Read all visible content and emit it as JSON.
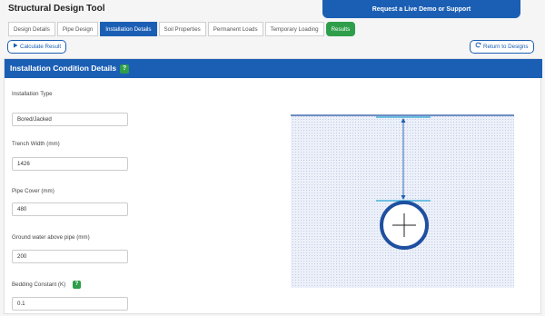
{
  "app": {
    "title": "Structural Design Tool",
    "demo_banner": "Request a Live Demo or Support"
  },
  "tabs": [
    {
      "label": "Design Details"
    },
    {
      "label": "Pipe Design"
    },
    {
      "label": "Installation Details"
    },
    {
      "label": "Soil Properties"
    },
    {
      "label": "Permanent Loads"
    },
    {
      "label": "Temporary Loading"
    },
    {
      "label": "Results"
    }
  ],
  "active_tab": "Installation Details",
  "toolbar": {
    "calculate_label": "Calculate Result",
    "return_label": "Return to Designs"
  },
  "section": {
    "title": "Installation Condition Details",
    "help": "?"
  },
  "fields": {
    "installation_type": {
      "label": "Installation Type",
      "value": "Bored/Jacked"
    },
    "trench_width": {
      "label": "Trench Width (mm)",
      "value": "1426"
    },
    "pipe_cover": {
      "label": "Pipe Cover (mm)",
      "value": "480"
    },
    "ground_water": {
      "label": "Ground water above pipe (mm)",
      "value": "200"
    },
    "bedding_constant": {
      "label": "Bedding Constant (K)",
      "value": "0.1",
      "help": "?"
    }
  },
  "icons": {
    "calculate": "play-icon",
    "return": "refresh-icon",
    "help": "question-icon"
  },
  "colors": {
    "primary": "#1b5fb5",
    "success": "#2e9e4a",
    "soil": "#e6ebf7",
    "water_line": "#2aa7d6",
    "pipe_ring": "#1e4fa0"
  }
}
